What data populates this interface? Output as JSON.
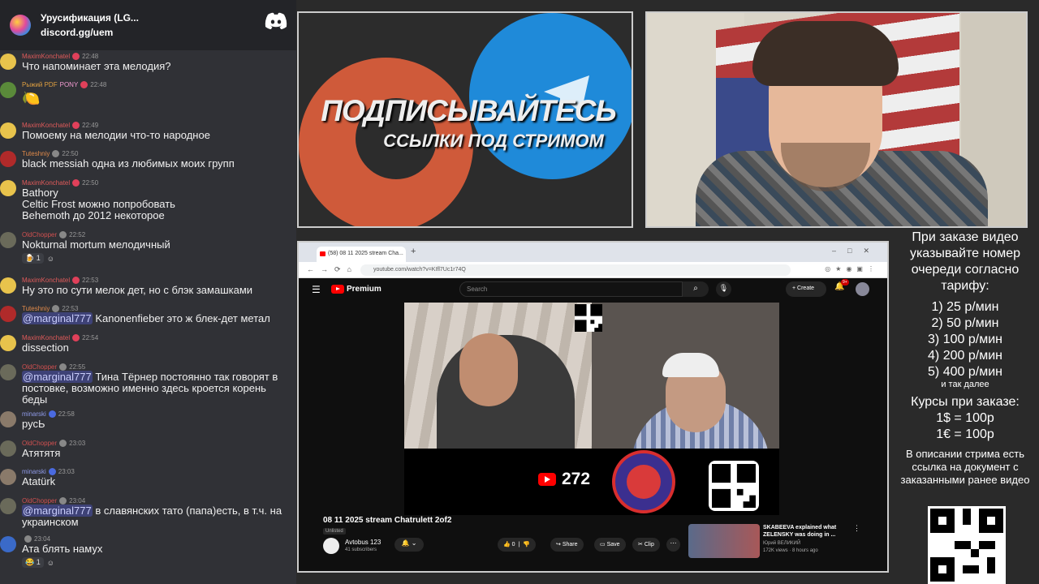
{
  "discord": {
    "server_name": "Урусификация (LG...",
    "server_link": "discord.gg/uem"
  },
  "messages": [
    {
      "name": "MaximKonchatel",
      "time": "22:48",
      "text": "Что напоминает эта мелодия?"
    },
    {
      "name": "Рыжий PDF",
      "tag": "PONY",
      "time": "22:48",
      "text": "🍋"
    },
    {
      "name": "MaximKonchatel",
      "time": "22:49",
      "text": "Помоему на мелодии что-то народное"
    },
    {
      "name": "Tuteshniy",
      "time": "22:50",
      "text": "black messiah одна из любимых моих групп"
    },
    {
      "name": "MaximKonchatel",
      "time": "22:50",
      "text1": "Bathory",
      "text2": "Celtic Frost можно попробовать",
      "text3": "Behemoth до 2012 некоторое"
    },
    {
      "name": "OldChopper",
      "time": "22:52",
      "text": "Nokturnal mortum мелодичный",
      "reaction_count": "1"
    },
    {
      "name": "MaximKonchatel",
      "time": "22:53",
      "text": "Ну это по сути мелок дет, но с блэк замашками"
    },
    {
      "name": "Tuteshniy",
      "time": "22:53",
      "mention": "@marginal777",
      "text": " Kanonenfieber это ж блек-дет метал"
    },
    {
      "name": "MaximKonchatel",
      "time": "22:54",
      "text": "dissection"
    },
    {
      "name": "OldChopper",
      "time": "22:55",
      "mention": "@marginal777",
      "text": " Тина Тёрнер постоянно так говорят в постовке, возможно именно здесь кроется корень беды"
    },
    {
      "name": "minarski",
      "time": "22:58",
      "text": "русЬ"
    },
    {
      "name": "OldChopper",
      "time": "23:03",
      "text": "Атятятя"
    },
    {
      "name": "minarski",
      "time": "23:03",
      "text": "Atatürk"
    },
    {
      "name": "OldChopper",
      "time": "23:04",
      "mention": "@marginal777",
      "text": " в славянских тато (папа)есть, в т.ч. на украинском"
    },
    {
      "name": "",
      "time": "23:04",
      "text": "Ата блять намух",
      "reaction_count": "1"
    }
  ],
  "promo": {
    "headline": "ПОДПИСЫВАЙТЕСЬ",
    "subline": "ССЫЛКИ ПОД СТРИМОМ"
  },
  "browser": {
    "tab_title": "(58) 08 11 2025 stream Cha...",
    "url": "youtube.com/watch?v=KIfl7Uc1r74Q"
  },
  "youtube": {
    "logo": "Premium",
    "search_placeholder": "Search",
    "create": "Create",
    "notif_count": "9+",
    "subs_overlay": "272",
    "video_title": "08 11 2025 stream Chatrulett 2of2",
    "unlisted": "Unlisted",
    "channel": "Avtobus 123",
    "channel_subs": "41 subscribers",
    "likes": "0",
    "share": "Share",
    "save": "Save",
    "clip": "Clip",
    "rec_title": "SKABEEVA explained what ZELENSKY was doing in ...",
    "rec_channel": "Юрий ВЕЛИКИЙ",
    "rec_views": "172K views · 8 hours ago"
  },
  "info": {
    "title": "При заказе видео указывайте номер очереди согласно тарифу:",
    "rates": [
      "1) 25 р/мин",
      "2) 50 р/мин",
      "3) 100 р/мин",
      "4) 200 р/мин",
      "5) 400 р/мин"
    ],
    "etc": "и так далее",
    "courses_title": "Курсы при заказе:",
    "course1": "1$ = 100р",
    "course2": "1€ = 100р",
    "note": "В описании стрима есть ссылка на документ с заказанными ранее видео"
  }
}
